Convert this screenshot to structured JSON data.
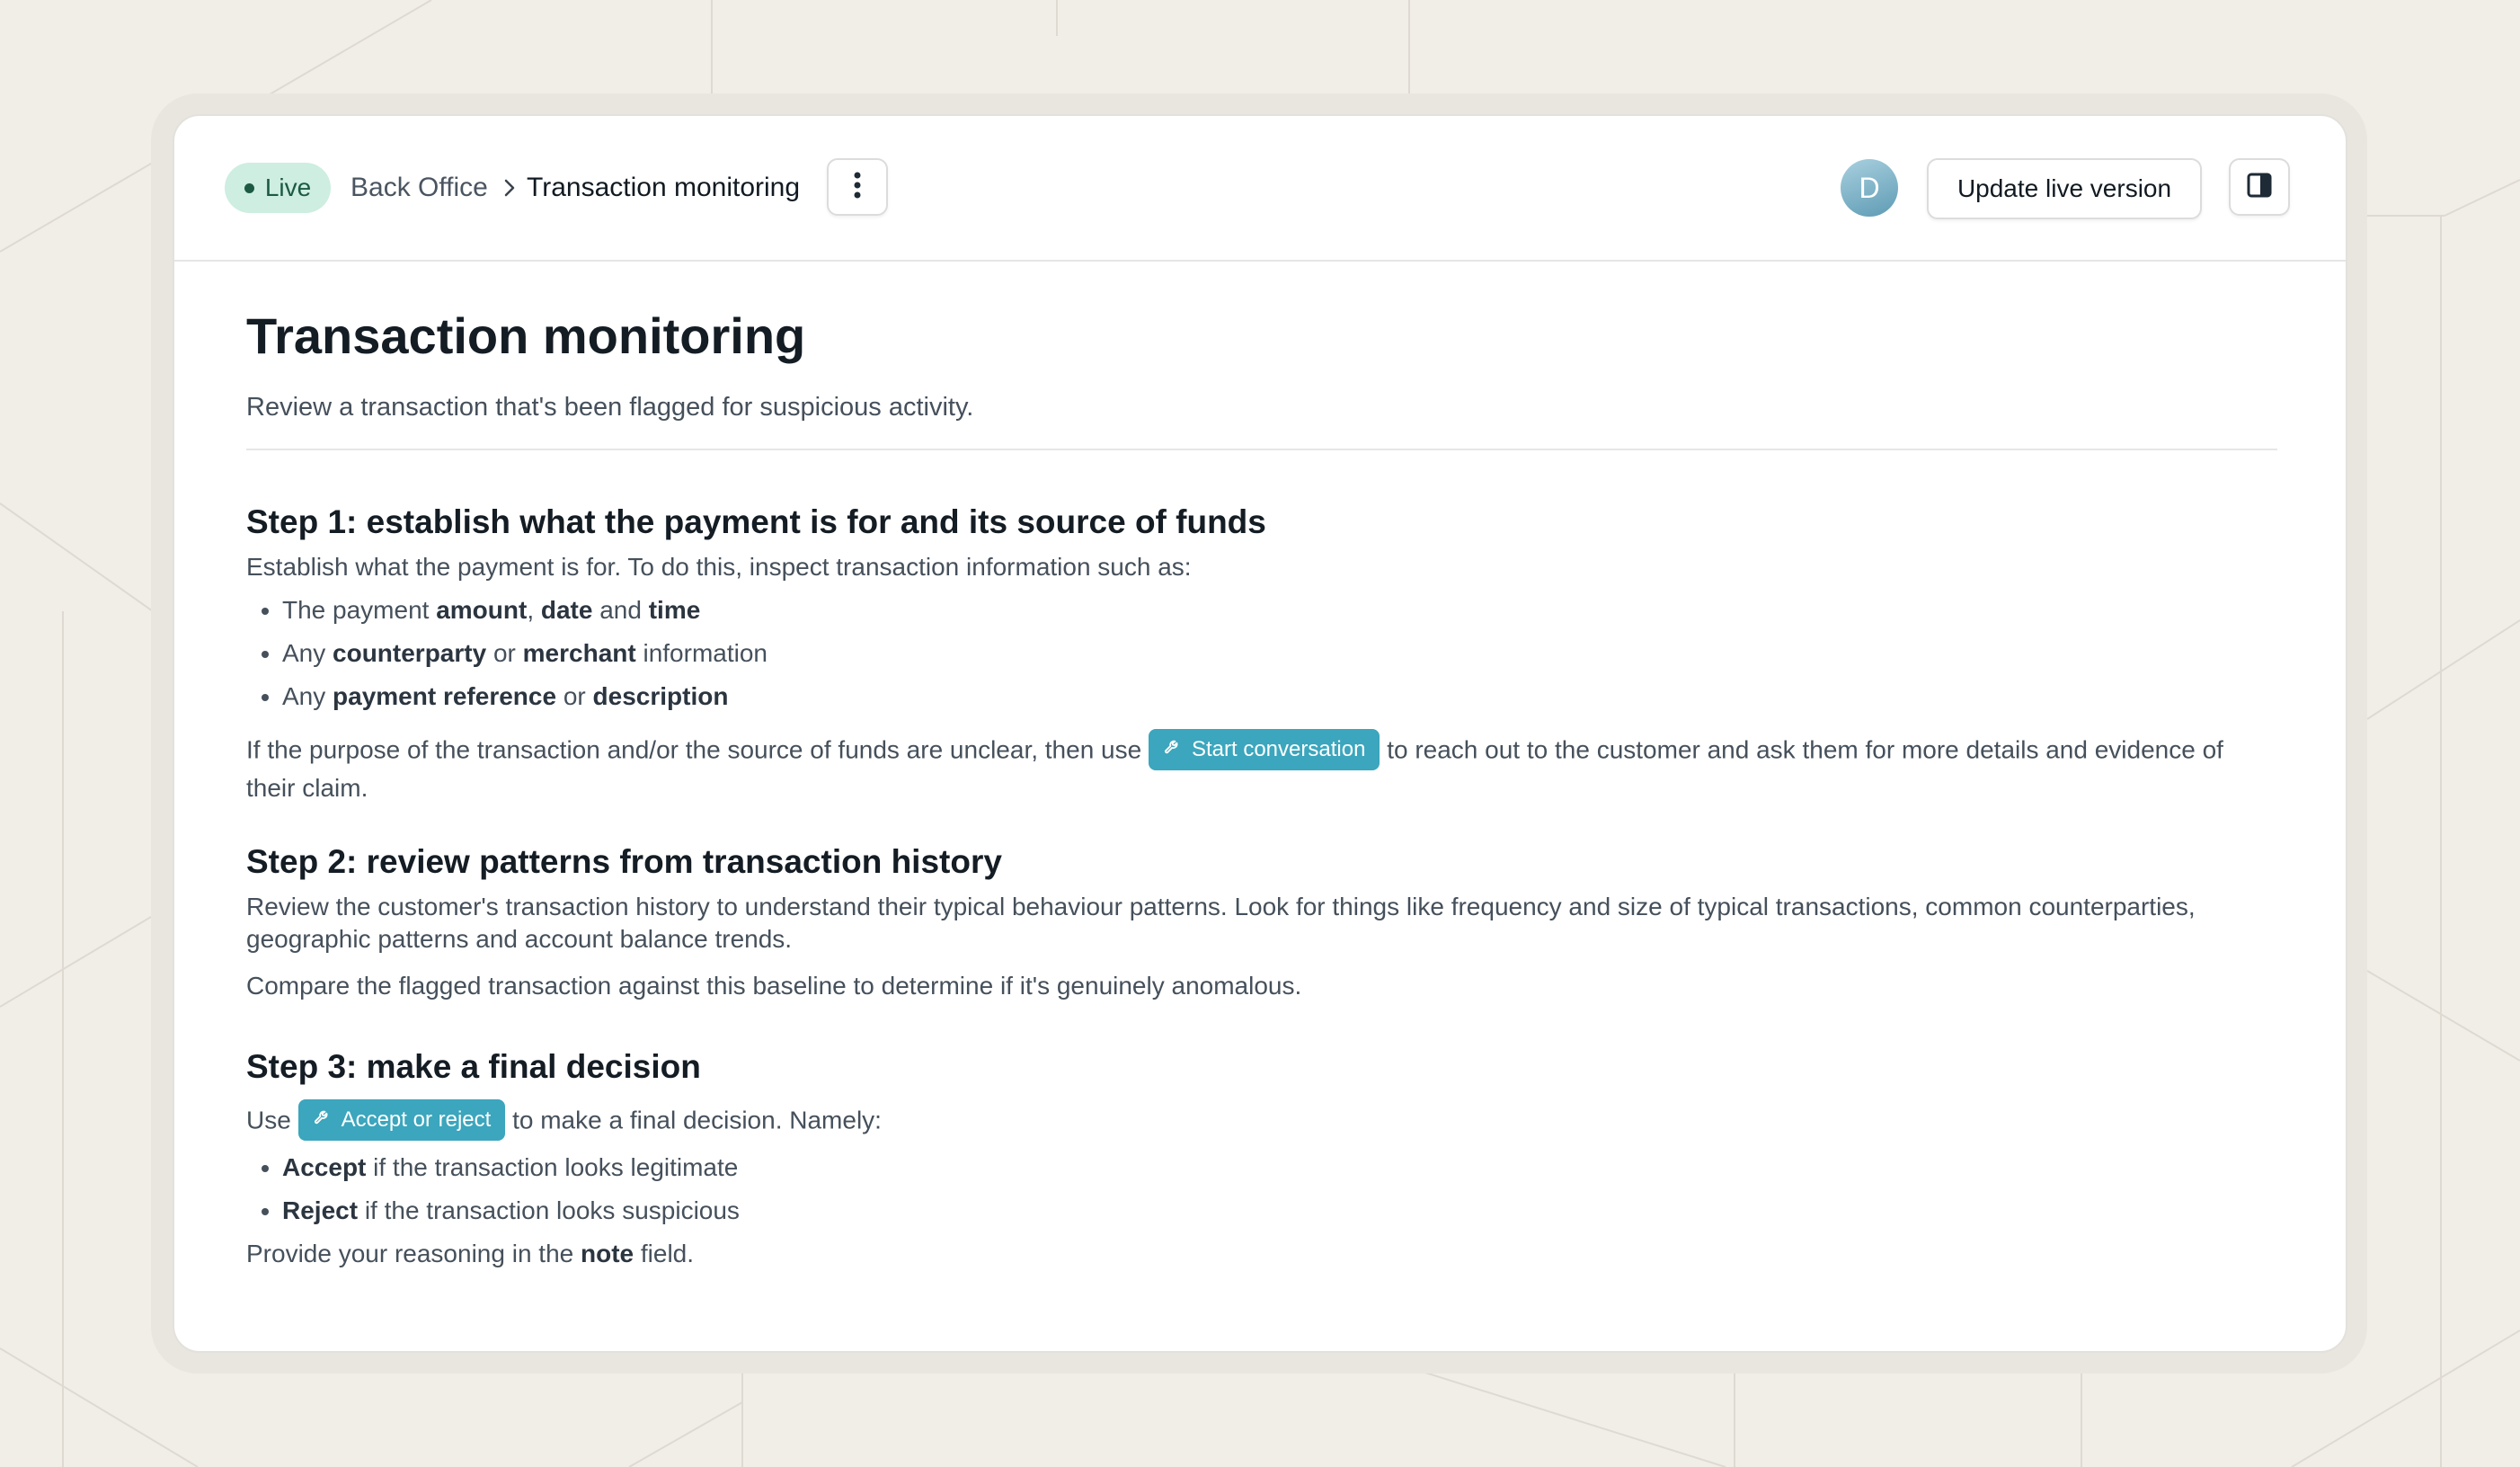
{
  "header": {
    "status_label": "Live",
    "breadcrumb": {
      "parent": "Back Office",
      "separator": ">",
      "current": "Transaction monitoring"
    },
    "avatar_initial": "D",
    "update_button_label": "Update live version"
  },
  "doc": {
    "title": "Transaction monitoring",
    "subtitle": "Review a transaction that's been flagged for suspicious activity.",
    "step1": {
      "heading": "Step 1: establish what the payment is for and its source of funds",
      "intro": "Establish what the payment is for. To do this, inspect transaction information such as:",
      "b1": {
        "t1": "The payment ",
        "s1": "amount",
        "t2": ", ",
        "s2": "date",
        "t3": " and ",
        "s3": "time"
      },
      "b2": {
        "t1": "Any ",
        "s1": "counterparty",
        "t2": " or ",
        "s2": "merchant",
        "t3": " information"
      },
      "b3": {
        "t1": "Any ",
        "s1": "payment reference",
        "t2": " or ",
        "s2": "description"
      },
      "para_before": "If the purpose of the transaction and/or the source of funds are unclear, then use ",
      "tool_label": "Start conversation",
      "para_after": " to reach out to the customer and ask them for more details and evidence of their claim."
    },
    "step2": {
      "heading": "Step 2: review patterns from transaction history",
      "p1": "Review the customer's transaction history to understand their typical behaviour patterns. Look for things like frequency and size of typical transactions, common counterparties, geographic patterns and account balance trends.",
      "p2": "Compare the flagged transaction against this baseline to determine if it's genuinely anomalous."
    },
    "step3": {
      "heading": "Step 3: make a final decision",
      "use_before": "Use ",
      "tool_label": "Accept or reject",
      "use_after": " to make a final decision. Namely:",
      "b1": {
        "s1": "Accept",
        "t1": " if the transaction looks legitimate"
      },
      "b2": {
        "s1": "Reject",
        "t1": " if the transaction looks suspicious"
      },
      "final": {
        "t1": "Provide your reasoning in the ",
        "s1": "note",
        "t2": " field."
      }
    }
  },
  "colors": {
    "accent": "#3ba6bd",
    "live_badge_bg": "#cdeee0",
    "live_badge_text": "#1d5a44",
    "page_bg": "#f1eee8"
  },
  "icons": {
    "more": "vertical-ellipsis-icon",
    "panel": "sidebar-panel-icon",
    "tool": "wrench-icon"
  }
}
